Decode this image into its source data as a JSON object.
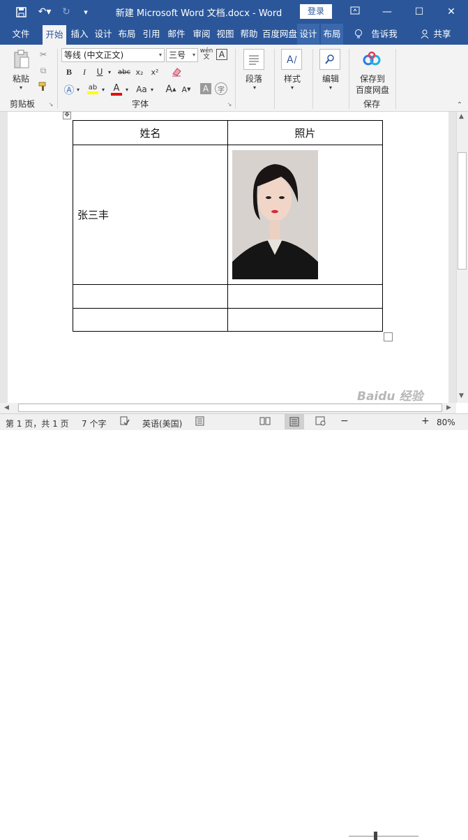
{
  "titlebar": {
    "title": "新建 Microsoft Word 文档.docx  -  Word",
    "login": "登录"
  },
  "tabs": [
    "文件",
    "开始",
    "插入",
    "设计",
    "布局",
    "引用",
    "邮件",
    "审阅",
    "视图",
    "帮助",
    "百度网盘",
    "设计",
    "布局"
  ],
  "tell_me": "告诉我",
  "share": "共享",
  "ribbon": {
    "clipboard": {
      "paste": "粘贴",
      "label": "剪贴板"
    },
    "font": {
      "name": "等线 (中文正文)",
      "size": "三号",
      "label": "字体",
      "wen": "wén",
      "bold": "B",
      "italic": "I",
      "underline": "U",
      "strike": "abc",
      "sub": "x₂",
      "sup": "x²",
      "aa": "Aa",
      "grow": "A",
      "shrink": "A"
    },
    "paragraph": {
      "label": "段落"
    },
    "styles": {
      "label": "样式"
    },
    "editing": {
      "label": "编辑"
    },
    "save": {
      "line1": "保存到",
      "line2": "百度网盘",
      "label": "保存"
    }
  },
  "table": {
    "headers": [
      "姓名",
      "照片"
    ],
    "name": "张三丰"
  },
  "status": {
    "page": "第 1 页，共 1 页",
    "words": "7 个字",
    "lang": "英语(美国)",
    "zoom": "80%"
  },
  "watermark": "Baidu 经验"
}
